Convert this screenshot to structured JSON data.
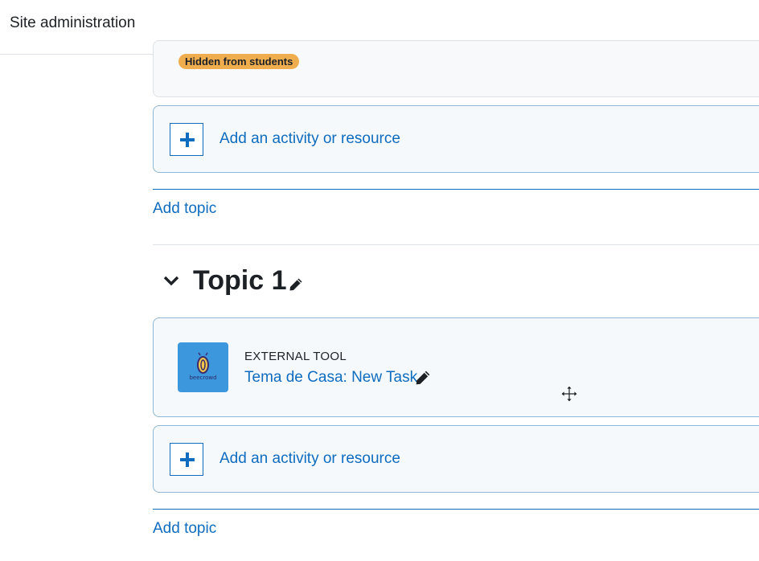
{
  "header": {
    "site_admin_label": "Site administration"
  },
  "section0": {
    "hidden_badge": "Hidden from students",
    "add_activity_label": "Add an activity or resource",
    "add_topic_label": "Add topic"
  },
  "topic1": {
    "title": "Topic 1",
    "activity": {
      "type": "EXTERNAL TOOL",
      "name": "Tema de Casa: New Task",
      "icon_text": "beecrowd",
      "icon_color": "#3d97dd"
    },
    "add_activity_label": "Add an activity or resource",
    "add_topic_label": "Add topic"
  },
  "colors": {
    "link": "#0f6cbf",
    "badge": "#f0ad4e",
    "card_bg": "#f5f9fc",
    "card_border": "#8fb7d3"
  },
  "icons": [
    "plus-icon",
    "chevron-down-icon",
    "pencil-icon",
    "move-cursor-icon",
    "beecrowd-logo-icon"
  ]
}
